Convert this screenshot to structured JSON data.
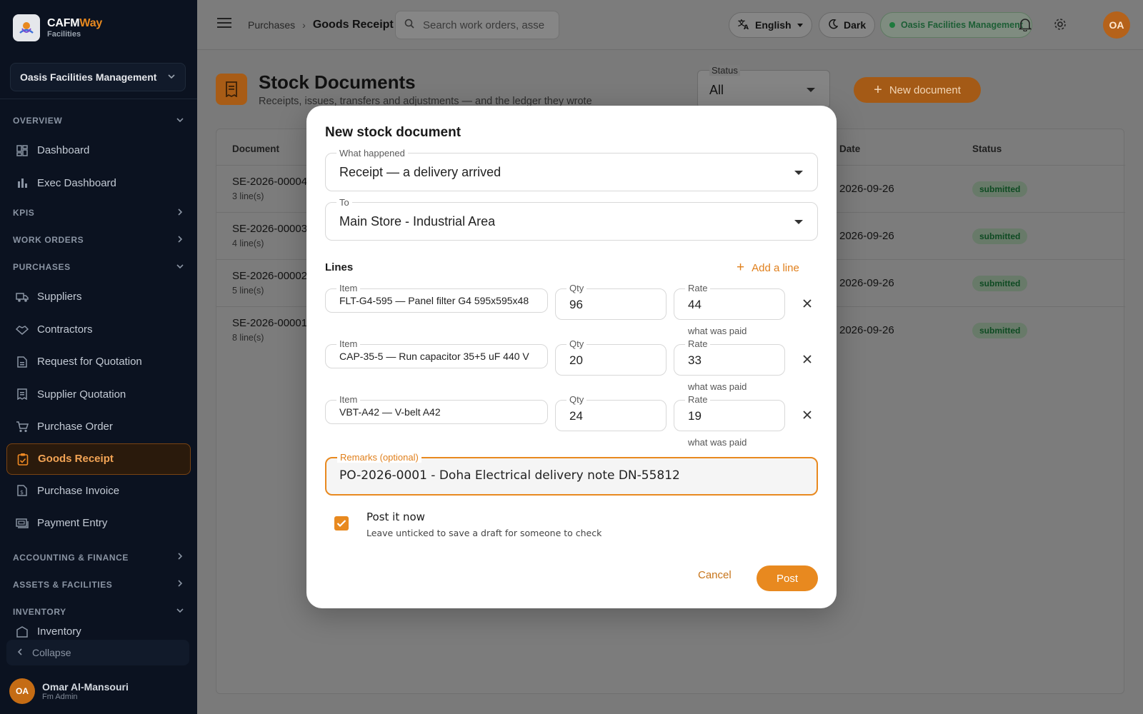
{
  "brand": {
    "name_primary": "CAFM",
    "name_accent": "Way",
    "subtitle": "Facilities"
  },
  "org_select": {
    "value": "Oasis Facilities Management"
  },
  "sidebar": {
    "sections": [
      {
        "label": "OVERVIEW",
        "expanded": true,
        "items": [
          {
            "label": "Dashboard",
            "icon": "dashboard-icon"
          },
          {
            "label": "Exec Dashboard",
            "icon": "bar-chart-icon"
          }
        ]
      },
      {
        "label": "KPIS",
        "expanded": false,
        "items": []
      },
      {
        "label": "WORK ORDERS",
        "expanded": false,
        "items": []
      },
      {
        "label": "PURCHASES",
        "expanded": true,
        "items": [
          {
            "label": "Suppliers",
            "icon": "truck-icon"
          },
          {
            "label": "Contractors",
            "icon": "handshake-icon"
          },
          {
            "label": "Request for Quotation",
            "icon": "document-icon"
          },
          {
            "label": "Supplier Quotation",
            "icon": "receipt-icon"
          },
          {
            "label": "Purchase Order",
            "icon": "cart-icon"
          },
          {
            "label": "Goods Receipt",
            "icon": "clipboard-icon",
            "active": true
          },
          {
            "label": "Purchase Invoice",
            "icon": "invoice-icon"
          },
          {
            "label": "Payment Entry",
            "icon": "payment-icon"
          }
        ]
      },
      {
        "label": "ACCOUNTING & FINANCE",
        "expanded": false,
        "items": []
      },
      {
        "label": "ASSETS & FACILITIES",
        "expanded": false,
        "items": []
      },
      {
        "label": "INVENTORY",
        "expanded": true,
        "items": [
          {
            "label": "Inventory",
            "icon": "inventory-icon"
          }
        ]
      }
    ],
    "collapse_label": "Collapse",
    "user": {
      "initials": "OA",
      "name": "Omar Al-Mansouri",
      "role": "Fm Admin"
    }
  },
  "topbar": {
    "breadcrumb": [
      "Purchases",
      "Goods Receipt"
    ],
    "search_placeholder": "Search work orders, asse…",
    "language": "English",
    "theme": "Dark",
    "org": "Oasis Facilities Management",
    "avatar": "OA"
  },
  "page": {
    "title": "Stock Documents",
    "subtitle": "Receipts, issues, transfers and adjustments — and the ledger they wrote",
    "status_filter": {
      "label": "Status",
      "value": "All"
    },
    "new_button": "New document",
    "columns": [
      "Document",
      "Date",
      "Status"
    ],
    "rows": [
      {
        "doc": "SE-2026-00004",
        "lines": "3 line(s)",
        "date": "2026-09-26",
        "status": "submitted"
      },
      {
        "doc": "SE-2026-00003",
        "lines": "4 line(s)",
        "date": "2026-09-26",
        "status": "submitted"
      },
      {
        "doc": "SE-2026-00002",
        "lines": "5 line(s)",
        "date": "2026-09-26",
        "status": "submitted"
      },
      {
        "doc": "SE-2026-00001",
        "lines": "8 line(s)",
        "date": "2026-09-26",
        "status": "submitted"
      }
    ]
  },
  "modal": {
    "title": "New stock document",
    "what_happened": {
      "label": "What happened",
      "value": "Receipt — a delivery arrived"
    },
    "to": {
      "label": "To",
      "value": "Main Store - Industrial Area"
    },
    "lines_label": "Lines",
    "add_line": "Add a line",
    "item_label": "Item",
    "qty_label": "Qty",
    "rate_label": "Rate",
    "rate_hint": "what was paid",
    "lines": [
      {
        "item": "FLT-G4-595 — Panel filter G4 595x595x48",
        "qty": "96",
        "rate": "44"
      },
      {
        "item": "CAP-35-5 — Run capacitor 35+5 uF 440 V",
        "qty": "20",
        "rate": "33"
      },
      {
        "item": "VBT-A42 — V-belt A42",
        "qty": "24",
        "rate": "19"
      }
    ],
    "remarks": {
      "label": "Remarks (optional)",
      "value": "PO-2026-0001 - Doha Electrical delivery note DN-55812"
    },
    "post_now": {
      "title": "Post it now",
      "subtitle": "Leave unticked to save a draft for someone to check",
      "checked": true
    },
    "cancel": "Cancel",
    "post": "Post"
  },
  "colors": {
    "accent": "#e8891f",
    "sidebar_bg": "#0b1220",
    "success": "#1e7a3d"
  }
}
